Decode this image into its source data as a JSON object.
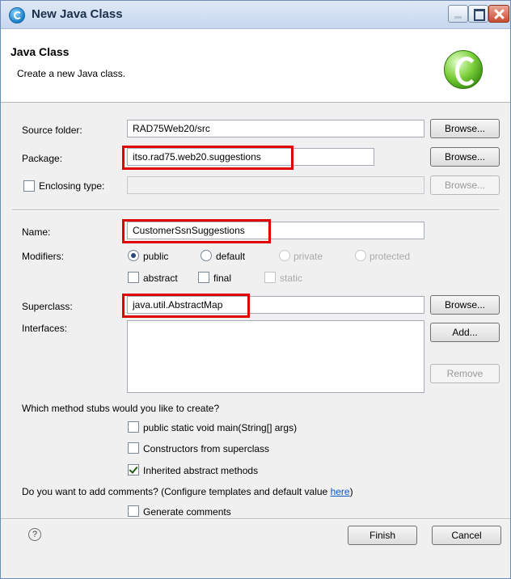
{
  "window": {
    "title": "New Java Class"
  },
  "banner": {
    "title": "Java Class",
    "description": "Create a new Java class."
  },
  "source_folder": {
    "label": "Source folder:",
    "value": "RAD75Web20/src",
    "browse": "Browse..."
  },
  "package": {
    "label": "Package:",
    "value": "itso.rad75.web20.suggestions",
    "browse": "Browse..."
  },
  "enclosing": {
    "label": "Enclosing type:",
    "value": "",
    "browse": "Browse..."
  },
  "name": {
    "label": "Name:",
    "value": "CustomerSsnSuggestions"
  },
  "modifiers": {
    "label": "Modifiers:",
    "public": "public",
    "default": "default",
    "private": "private",
    "protected": "protected",
    "abstract": "abstract",
    "final": "final",
    "static": "static"
  },
  "superclass": {
    "label": "Superclass:",
    "value": "java.util.AbstractMap",
    "browse": "Browse..."
  },
  "interfaces": {
    "label": "Interfaces:",
    "add": "Add...",
    "remove": "Remove"
  },
  "stubs": {
    "question": "Which method stubs would you like to create?",
    "main": "public static void main(String[] args)",
    "constructors": "Constructors from superclass",
    "inherited": "Inherited abstract methods"
  },
  "comments": {
    "question": "Do you want to add comments? (Configure templates and default value ",
    "link": "here",
    "close_paren": ")",
    "generate": "Generate comments"
  },
  "footer": {
    "help": "?",
    "finish": "Finish",
    "cancel": "Cancel"
  },
  "colors": {
    "highlight": "#e00000",
    "link": "#0a55c8"
  },
  "state": {
    "public_selected": true,
    "inherited_checked": true,
    "main_checked": false,
    "constructors_checked": false,
    "generate_comments_checked": false
  }
}
